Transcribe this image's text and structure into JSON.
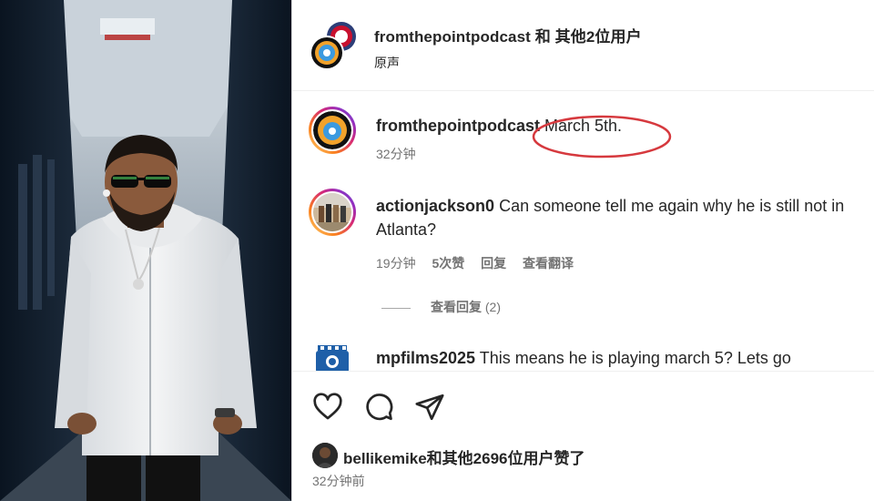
{
  "header": {
    "title": "fromthepointpodcast 和 其他2位用户",
    "subtitle": "原声"
  },
  "comments": [
    {
      "username": "fromthepointpodcast",
      "text": "March 5th.",
      "time": "32分钟",
      "meta": []
    },
    {
      "username": "actionjackson0",
      "text": "Can someone tell me again why he is still not in Atlanta?",
      "time": "19分钟",
      "meta": [
        "5次赞",
        "回复",
        "查看翻译"
      ]
    },
    {
      "username": "mpfilms2025",
      "text": "This means he is playing march 5? Lets go"
    }
  ],
  "view_replies": {
    "label": "查看回复",
    "count": "(2)"
  },
  "likes": {
    "text": "bellikemike和其他2696位用户赞了"
  },
  "time_ago": "32分钟前",
  "icons": [
    "heart-icon",
    "comment-icon",
    "share-icon"
  ],
  "colors": {
    "highlight": "#d6393e",
    "meta_text": "#737373",
    "primary_text": "#262626"
  }
}
